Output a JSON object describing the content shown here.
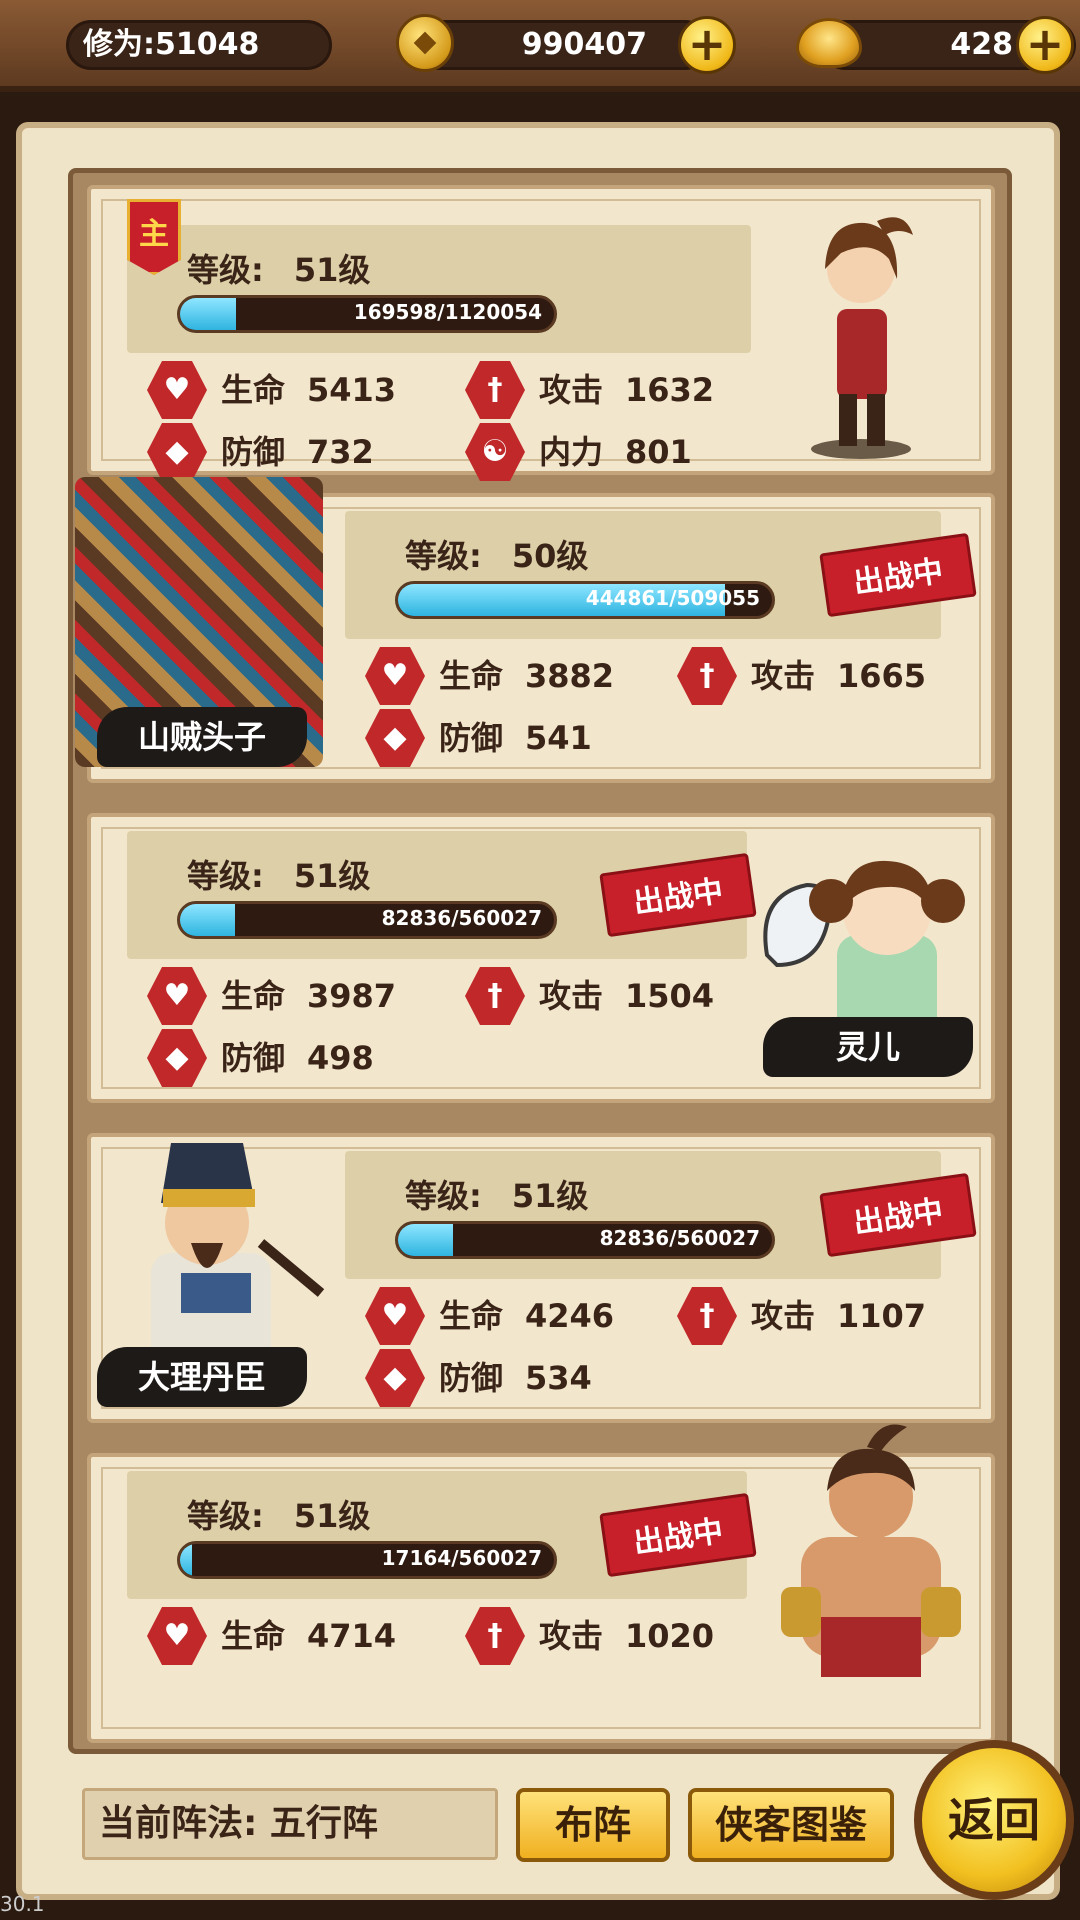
{
  "top_bar": {
    "cultivation_label": "修为:51048",
    "coins": "990407",
    "gold": "428",
    "plus": "+"
  },
  "heroes": [
    {
      "is_main": true,
      "main_badge": "主",
      "level_label": "等级:",
      "level": "51级",
      "xp": "169598/1120054",
      "xp_fraction": 0.151,
      "stats": [
        {
          "icon": "heart-icon",
          "label": "生命",
          "value": "5413"
        },
        {
          "icon": "sword-icon",
          "label": "攻击",
          "value": "1632"
        },
        {
          "icon": "shield-icon",
          "label": "防御",
          "value": "732"
        },
        {
          "icon": "yinyang-icon",
          "label": "内力",
          "value": "801"
        }
      ],
      "name": ""
    },
    {
      "level_label": "等级:",
      "level": "50级",
      "xp": "444861/509055",
      "xp_fraction": 0.874,
      "status": "出战中",
      "name": "山贼头子",
      "stats": [
        {
          "icon": "heart-icon",
          "label": "生命",
          "value": "3882"
        },
        {
          "icon": "sword-icon",
          "label": "攻击",
          "value": "1665"
        },
        {
          "icon": "shield-icon",
          "label": "防御",
          "value": "541"
        }
      ]
    },
    {
      "level_label": "等级:",
      "level": "51级",
      "xp": "82836/560027",
      "xp_fraction": 0.148,
      "status": "出战中",
      "name": "灵儿",
      "stats": [
        {
          "icon": "heart-icon",
          "label": "生命",
          "value": "3987"
        },
        {
          "icon": "sword-icon",
          "label": "攻击",
          "value": "1504"
        },
        {
          "icon": "shield-icon",
          "label": "防御",
          "value": "498"
        }
      ]
    },
    {
      "level_label": "等级:",
      "level": "51级",
      "xp": "82836/560027",
      "xp_fraction": 0.148,
      "status": "出战中",
      "name": "大理丹臣",
      "stats": [
        {
          "icon": "heart-icon",
          "label": "生命",
          "value": "4246"
        },
        {
          "icon": "sword-icon",
          "label": "攻击",
          "value": "1107"
        },
        {
          "icon": "shield-icon",
          "label": "防御",
          "value": "534"
        }
      ]
    },
    {
      "level_label": "等级:",
      "level": "51级",
      "xp": "17164/560027",
      "xp_fraction": 0.031,
      "status": "出战中",
      "name": "",
      "stats": [
        {
          "icon": "heart-icon",
          "label": "生命",
          "value": "4714"
        },
        {
          "icon": "sword-icon",
          "label": "攻击",
          "value": "1020"
        }
      ]
    }
  ],
  "bottom_bar": {
    "formation": "当前阵法: 五行阵",
    "array_button": "布阵",
    "atlas_button": "侠客图鉴",
    "back_button": "返回"
  },
  "version": "30.1"
}
